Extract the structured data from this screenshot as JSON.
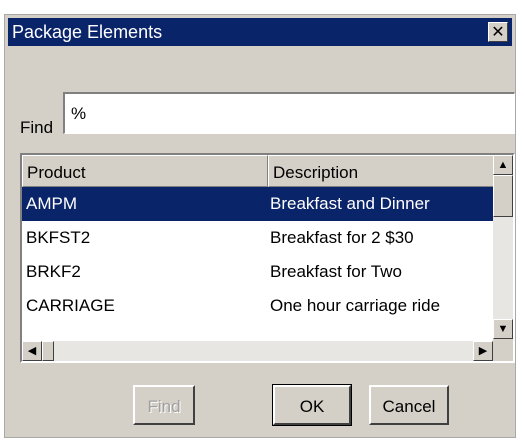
{
  "window": {
    "title": "Package Elements",
    "close_glyph": "✕"
  },
  "search": {
    "label": "Find",
    "value": "%"
  },
  "table": {
    "columns": [
      "Product",
      "Description"
    ],
    "rows": [
      {
        "product": "AMPM",
        "description": "Breakfast and Dinner",
        "selected": true
      },
      {
        "product": "BKFST2",
        "description": "Breakfast for 2 $30",
        "selected": false
      },
      {
        "product": "BRKF2",
        "description": "Breakfast for Two",
        "selected": false
      },
      {
        "product": "CARRIAGE",
        "description": "One hour carriage ride",
        "selected": false
      }
    ]
  },
  "buttons": {
    "find": "Find",
    "ok": "OK",
    "cancel": "Cancel"
  },
  "colors": {
    "titlebar": "#0a246a",
    "dialog_face": "#d4d0c8",
    "selection": "#0a246a"
  }
}
